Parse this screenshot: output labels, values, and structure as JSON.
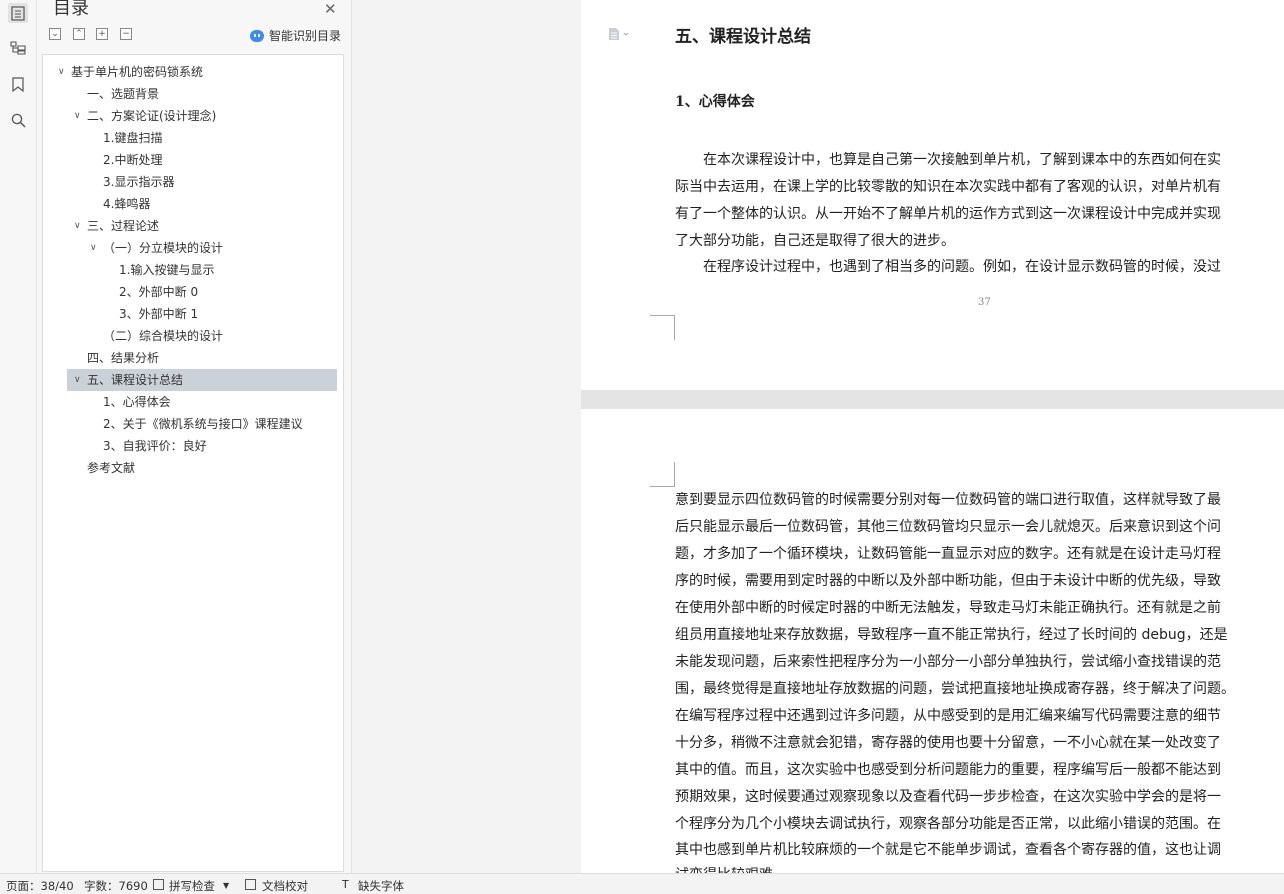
{
  "nav": {
    "title": "目录",
    "smart_label": "智能识别目录",
    "tree": [
      {
        "label": "基于单片机的密码锁系统",
        "caret": "∨"
      },
      {
        "label": "一、选题背景"
      },
      {
        "label": "二、方案论证(设计理念)",
        "caret": "∨"
      },
      {
        "label": "1.键盘扫描"
      },
      {
        "label": "2.中断处理"
      },
      {
        "label": "3.显示指示器"
      },
      {
        "label": "4.蜂鸣器"
      },
      {
        "label": "三、过程论述",
        "caret": "∨"
      },
      {
        "label": "（一）分立模块的设计",
        "caret": "∨"
      },
      {
        "label": "1.输入按键与显示"
      },
      {
        "label": "2、外部中断 0"
      },
      {
        "label": "3、外部中断 1"
      },
      {
        "label": "（二）综合模块的设计"
      },
      {
        "label": "四、结果分析"
      },
      {
        "label": "五、课程设计总结",
        "caret": "∨",
        "selected": true
      },
      {
        "label": "1、心得体会"
      },
      {
        "label": "2、关于《微机系统与接口》课程建议"
      },
      {
        "label": "3、自我评价：良好"
      },
      {
        "label": "参考文献"
      }
    ]
  },
  "doc": {
    "heading1": "五、课程设计总结",
    "heading2": "1、心得体会",
    "page1_lines": [
      "　　在本次课程设计中，也算是自己第一次接触到单片机，了解到课本中的东西如何在实",
      "际当中去运用，在课上学的比较零散的知识在本次实践中都有了客观的认识，对单片机有",
      "有了一个整体的认识。从一开始不了解单片机的运作方式到这一次课程设计中完成并实现",
      "了大部分功能，自己还是取得了很大的进步。",
      "　　在程序设计过程中，也遇到了相当多的问题。例如，在设计显示数码管的时候，没过"
    ],
    "page_number": "37",
    "page2_lines": [
      "意到要显示四位数码管的时候需要分别对每一位数码管的端口进行取值，这样就导致了最",
      "后只能显示最后一位数码管，其他三位数码管均只显示一会儿就熄灭。后来意识到这个问",
      "题，才多加了一个循环模块，让数码管能一直显示对应的数字。还有就是在设计走马灯程",
      "序的时候，需要用到定时器的中断以及外部中断功能，但由于未设计中断的优先级，导致",
      "在使用外部中断的时候定时器的中断无法触发，导致走马灯未能正确执行。还有就是之前",
      "组员用直接地址来存放数据，导致程序一直不能正常执行，经过了长时间的 debug，还是",
      "未能发现问题，后来索性把程序分为一小部分一小部分单独执行，尝试缩小查找错误的范",
      "围，最终觉得是直接地址存放数据的问题，尝试把直接地址换成寄存器，终于解决了问题。",
      "在编写程序过程中还遇到过许多问题，从中感受到的是用汇编来编写代码需要注意的细节",
      "十分多，稍微不注意就会犯错，寄存器的使用也要十分留意，一不小心就在某一处改变了",
      "其中的值。而且，这次实验中也感受到分析问题能力的重要，程序编写后一般都不能达到",
      "预期效果，这时候要通过观察现象以及查看代码一步步检查，在这次实验中学会的是将一",
      "个程序分为几个小模块去调试执行，观察各部分功能是否正常，以此缩小错误的范围。在",
      "其中也感到单片机比较麻烦的一个就是它不能单步调试，查看各个寄存器的值，这也让调",
      "试变得比较艰难。"
    ]
  },
  "status": {
    "page": "页面：38/40",
    "words": "字数：7690",
    "spell": "拼写检查",
    "proof": "文档校对",
    "missing_font": "缺失字体"
  }
}
